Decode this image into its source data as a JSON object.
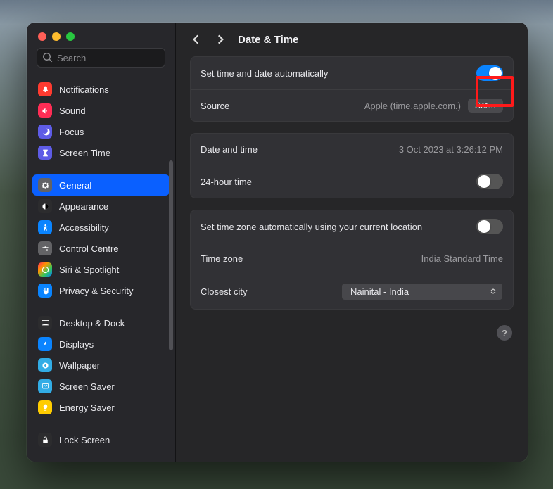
{
  "search": {
    "placeholder": "Search"
  },
  "page": {
    "title": "Date & Time"
  },
  "sidebar": {
    "items": [
      {
        "label": "Notifications"
      },
      {
        "label": "Sound"
      },
      {
        "label": "Focus"
      },
      {
        "label": "Screen Time"
      },
      {
        "label": "General"
      },
      {
        "label": "Appearance"
      },
      {
        "label": "Accessibility"
      },
      {
        "label": "Control Centre"
      },
      {
        "label": "Siri & Spotlight"
      },
      {
        "label": "Privacy & Security"
      },
      {
        "label": "Desktop & Dock"
      },
      {
        "label": "Displays"
      },
      {
        "label": "Wallpaper"
      },
      {
        "label": "Screen Saver"
      },
      {
        "label": "Energy Saver"
      },
      {
        "label": "Lock Screen"
      }
    ]
  },
  "rows": {
    "auto_time_label": "Set time and date automatically",
    "source_label": "Source",
    "source_value": "Apple (time.apple.com.)",
    "set_btn": "Set…",
    "date_time_label": "Date and time",
    "date_time_value": "3 Oct 2023 at 3:26:12 PM",
    "twentyfour_label": "24-hour time",
    "auto_tz_label": "Set time zone automatically using your current location",
    "tz_label": "Time zone",
    "tz_value": "India Standard Time",
    "city_label": "Closest city",
    "city_value": "Nainital - India"
  },
  "help": {
    "label": "?"
  }
}
